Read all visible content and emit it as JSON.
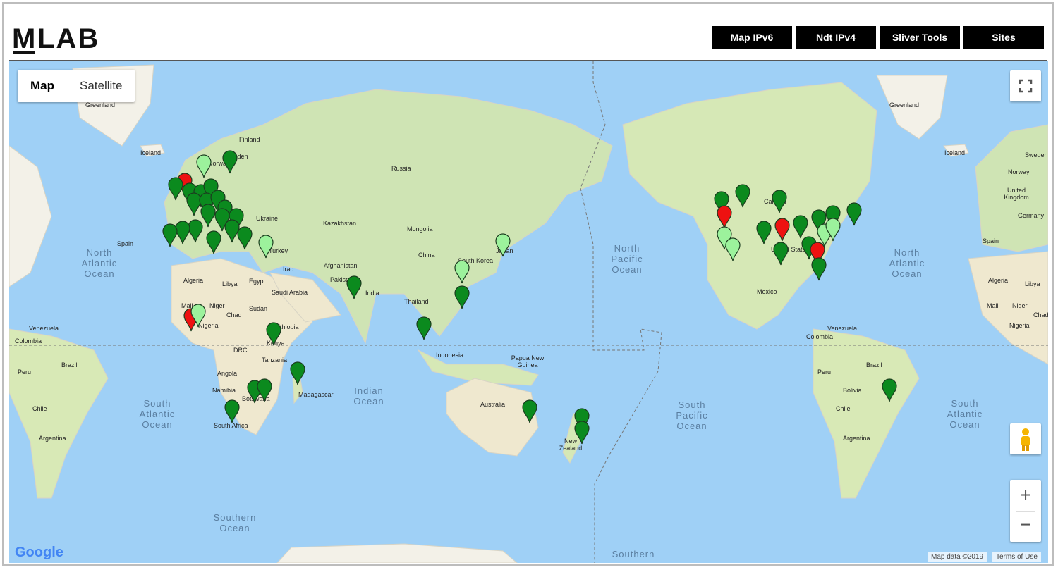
{
  "brand": {
    "logo_m": "M",
    "logo_rest": "LAB"
  },
  "nav": {
    "items": [
      {
        "label": "Map IPv6"
      },
      {
        "label": "Ndt IPv4"
      },
      {
        "label": "Sliver Tools"
      },
      {
        "label": "Sites"
      }
    ]
  },
  "map": {
    "type_control": {
      "map_label": "Map",
      "satellite_label": "Satellite",
      "selected": "Map"
    },
    "controls": {
      "fullscreen_icon": "fullscreen-icon",
      "pegman_icon": "pegman-icon",
      "zoom_in": "+",
      "zoom_out": "−"
    },
    "oceans": [
      "North Atlantic Ocean",
      "North Pacific Ocean",
      "North Atlantic Ocean",
      "Indian Ocean",
      "South Atlantic Ocean",
      "South Pacific Ocean",
      "South Atlantic Ocean",
      "Southern Ocean",
      "Southern"
    ],
    "labels": [
      "Greenland",
      "Iceland",
      "Finland",
      "Sweden",
      "Norway",
      "Russia",
      "Ukraine",
      "Kazakhstan",
      "Mongolia",
      "China",
      "South Korea",
      "Japan",
      "Turkey",
      "Iraq",
      "Afghanistan",
      "Pakistan",
      "India",
      "Egypt",
      "Libya",
      "Algeria",
      "Saudi Arabia",
      "Sudan",
      "Chad",
      "Niger",
      "Mali",
      "Nigeria",
      "Ethiopia",
      "Kenya",
      "DRC",
      "Tanzania",
      "Angola",
      "Namibia",
      "Botswana",
      "Madagascar",
      "South Africa",
      "Thailand",
      "Indonesia",
      "Papua New Guinea",
      "Australia",
      "New Zealand",
      "Spain",
      "Venezuela",
      "Colombia",
      "Brazil",
      "Peru",
      "Chile",
      "Argentina",
      "Canada",
      "United States",
      "Mexico",
      "Greenland",
      "Iceland",
      "Sweden",
      "Norway",
      "United Kingdom",
      "Germany",
      "Spain",
      "Algeria",
      "Libya",
      "Mali",
      "Niger",
      "Chad",
      "Nigeria",
      "Venezuela",
      "Colombia",
      "Brazil",
      "Peru",
      "Bolivia",
      "Chile",
      "Argentina"
    ],
    "attribution": {
      "google": "Google",
      "map_data": "Map data ©2019",
      "terms": "Terms of Use"
    },
    "pin_colors": {
      "up": "#0b8a1e",
      "partial": "#9cf29c",
      "down": "#ee1111"
    }
  }
}
